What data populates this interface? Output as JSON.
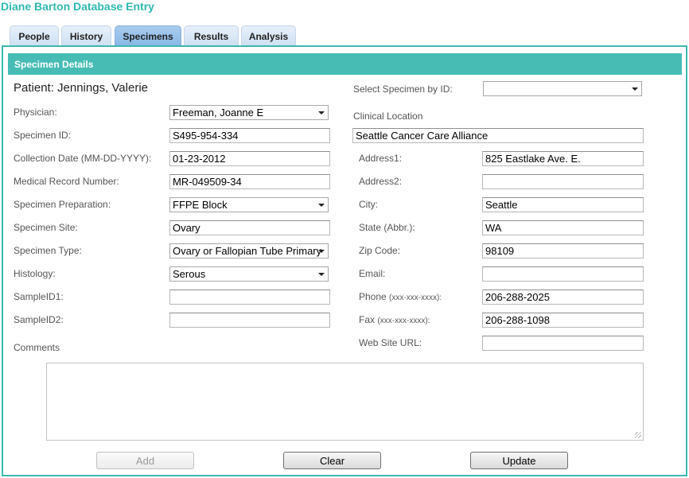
{
  "app": {
    "title": "Diane Barton Database Entry"
  },
  "tabs": [
    {
      "label": "People",
      "active": false
    },
    {
      "label": "History",
      "active": false
    },
    {
      "label": "Specimens",
      "active": true
    },
    {
      "label": "Results",
      "active": false
    },
    {
      "label": "Analysis",
      "active": false
    }
  ],
  "panel": {
    "header": "Specimen Details"
  },
  "patient": {
    "text": "Patient: Jennings, Valerie"
  },
  "left": {
    "physician": {
      "label": "Physician:",
      "value": "Freeman, Joanne E"
    },
    "specimen_id": {
      "label": "Specimen ID:",
      "value": "S495-954-334"
    },
    "collection_date": {
      "label": "Collection Date (MM-DD-YYYY):",
      "value": "01-23-2012"
    },
    "medical_record": {
      "label": "Medical Record Number:",
      "value": "MR-049509-34"
    },
    "preparation": {
      "label": "Specimen Preparation:",
      "value": "FFPE Block"
    },
    "site": {
      "label": "Specimen Site:",
      "value": "Ovary"
    },
    "type": {
      "label": "Specimen Type:",
      "value": "Ovary or Fallopian Tube Primary"
    },
    "histology": {
      "label": "Histology:",
      "value": "Serous"
    },
    "sample_id1": {
      "label": "SampleID1:",
      "value": ""
    },
    "sample_id2": {
      "label": "SampleID2:",
      "value": ""
    },
    "comments": {
      "label": "Comments",
      "value": ""
    }
  },
  "right": {
    "select_specimen": {
      "label": "Select Specimen by ID:",
      "value": ""
    },
    "clinical_location": {
      "label": "Clinical Location",
      "value": "Seattle Cancer Care Alliance"
    },
    "address1": {
      "label": "Address1:",
      "value": "825  Eastlake Ave. E."
    },
    "address2": {
      "label": "Address2:",
      "value": ""
    },
    "city": {
      "label": "City:",
      "value": "Seattle"
    },
    "state": {
      "label": "State (Abbr.):",
      "value": "WA"
    },
    "zip": {
      "label": "Zip Code:",
      "value": "98109"
    },
    "email": {
      "label": "Email:",
      "value": ""
    },
    "phone": {
      "label": "Phone",
      "hint": "(xxx-xxx-xxxx):",
      "value": "206-288-2025"
    },
    "fax": {
      "label": "Fax",
      "hint": "(xxx-xxx-xxxx):",
      "value": "206-288-1098"
    },
    "website": {
      "label": "Web Site URL:",
      "value": ""
    }
  },
  "buttons": {
    "add": "Add",
    "clear": "Clear",
    "update": "Update"
  },
  "colors": {
    "accent": "#46bcb4",
    "title": "#30b8b0",
    "tab_active": "#8ab8e6",
    "tab": "#cfe0f2"
  }
}
